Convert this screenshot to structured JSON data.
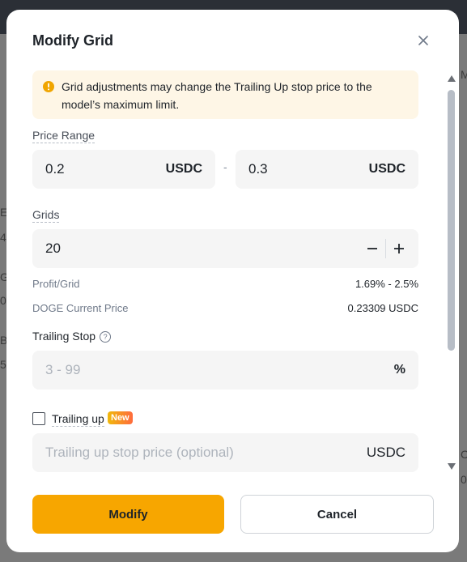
{
  "modal": {
    "title": "Modify Grid",
    "notice": "Grid adjustments may change the Trailing Up stop price to the model’s maximum limit."
  },
  "price_range": {
    "label": "Price Range",
    "lower": {
      "value": "0.2",
      "unit": "USDC"
    },
    "separator": "-",
    "upper": {
      "value": "0.3",
      "unit": "USDC"
    }
  },
  "grids": {
    "label": "Grids",
    "value": "20"
  },
  "info": {
    "profit_label": "Profit/Grid",
    "profit_value": "1.69% - 2.5%",
    "price_label": "DOGE Current Price",
    "price_value": "0.23309 USDC"
  },
  "trailing_stop": {
    "label": "Trailing Stop",
    "help_icon": "?",
    "placeholder": "3 - 99",
    "unit": "%"
  },
  "trailing_up": {
    "label": "Trailing up",
    "badge": "New",
    "checked": false,
    "placeholder": "Trailing up stop price (optional)",
    "unit": "USDC"
  },
  "buttons": {
    "modify": "Modify",
    "cancel": "Cancel"
  },
  "background": {
    "fragments": [
      "E",
      "4",
      "G",
      "0",
      "B",
      "5",
      "M",
      "C",
      "0"
    ]
  },
  "colors": {
    "accent": "#f7a600",
    "notice_bg": "#fef6e6",
    "field_bg": "#f5f5f5",
    "badge_from": "#f0b90b",
    "badge_to": "#ff6a3d"
  },
  "icons": {
    "close": "close-icon",
    "notice": "warning-icon",
    "minus": "minus-icon",
    "plus": "plus-icon",
    "scroll_up": "triangle-up-icon",
    "scroll_down": "triangle-down-icon"
  }
}
